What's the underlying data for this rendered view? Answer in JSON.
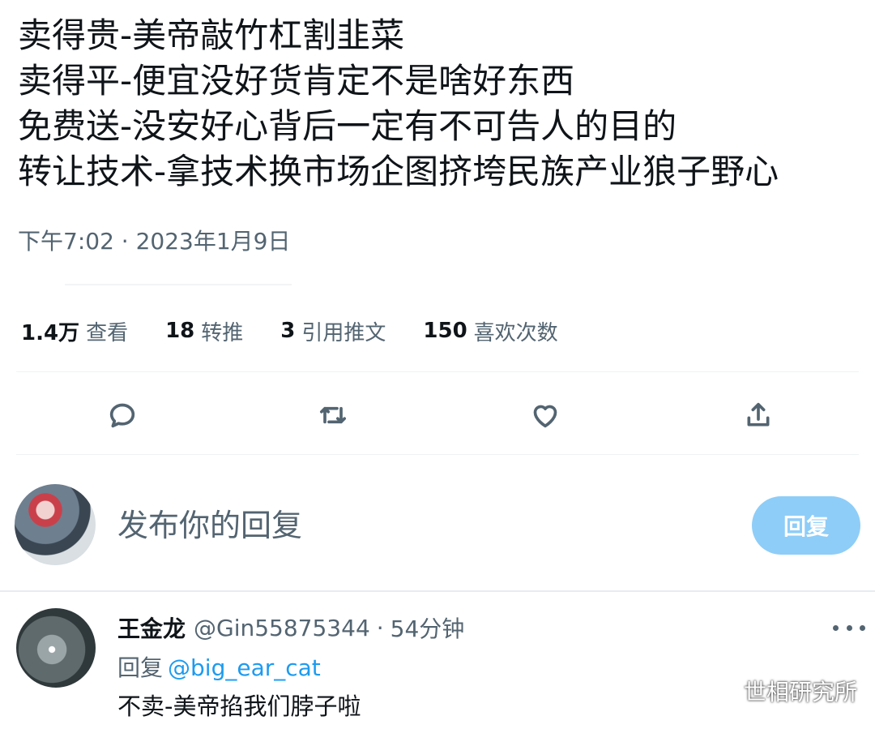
{
  "tweet": {
    "lines": [
      "卖得贵-美帝敲竹杠割韭菜",
      "卖得平-便宜没好货肯定不是啥好东西",
      "免费送-没安好心背后一定有不可告人的目的",
      "转让技术-拿技术换市场企图挤垮民族产业狼子野心"
    ],
    "timestamp": "下午7:02 · 2023年1月9日"
  },
  "stats": [
    {
      "num": "1.4万",
      "label": "查看"
    },
    {
      "num": "18",
      "label": "转推"
    },
    {
      "num": "3",
      "label": "引用推文"
    },
    {
      "num": "150",
      "label": "喜欢次数"
    }
  ],
  "actions": {
    "reply_icon": "comment-icon",
    "retweet_icon": "retweet-icon",
    "like_icon": "heart-icon",
    "share_icon": "share-icon"
  },
  "compose": {
    "placeholder": "发布你的回复",
    "button": "回复",
    "button_color": "#8ecdf8"
  },
  "reply": {
    "name": "王金龙",
    "handle": "@Gin55875344",
    "time": "54分钟",
    "replying_label": "回复",
    "mention": "@big_ear_cat",
    "text": "不卖-美帝掐我们脖子啦"
  },
  "watermark": "世相研究所",
  "colors": {
    "text": "#0f1419",
    "muted": "#536471",
    "link": "#1d9bf0",
    "divider": "#eff3f4"
  }
}
